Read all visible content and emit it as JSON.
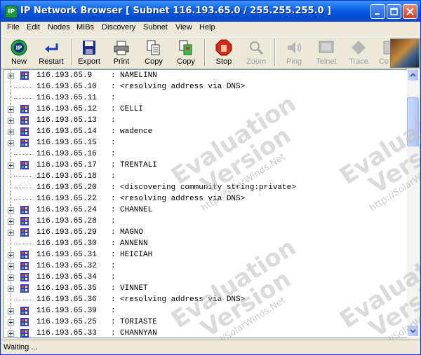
{
  "window": {
    "title": "IP Network Browser [ Subnet 116.193.65.0 / 255.255.255.0 ]",
    "app_icon_text": "IP"
  },
  "menu": [
    "File",
    "Edit",
    "Nodes",
    "MIBs",
    "Discovery",
    "Subnet",
    "View",
    "Help"
  ],
  "toolbar": {
    "new": "New",
    "restart": "Restart",
    "export": "Export",
    "print": "Print",
    "copy1": "Copy",
    "copy2": "Copy",
    "stop": "Stop",
    "zoom": "Zoom",
    "ping": "Ping",
    "telnet": "Telnet",
    "trace": "Trace",
    "co": "Co"
  },
  "rows": [
    {
      "ip": "116.193.65.9",
      "name": "NAMELINN",
      "expand": true
    },
    {
      "ip": "116.193.65.10",
      "name": "<resolving address via DNS>",
      "expand": false
    },
    {
      "ip": "116.193.65.11",
      "name": "",
      "expand": false
    },
    {
      "ip": "116.193.65.12",
      "name": "CELLI",
      "expand": true
    },
    {
      "ip": "116.193.65.13",
      "name": "",
      "expand": true
    },
    {
      "ip": "116.193.65.14",
      "name": "wadence",
      "expand": true
    },
    {
      "ip": "116.193.65.15",
      "name": "",
      "expand": true
    },
    {
      "ip": "116.193.65.16",
      "name": "",
      "expand": false
    },
    {
      "ip": "116.193.65.17",
      "name": "TRENTALI",
      "expand": true
    },
    {
      "ip": "116.193.65.18",
      "name": "",
      "expand": false
    },
    {
      "ip": "116.193.65.20",
      "name": "<discovering community string:private>",
      "expand": false
    },
    {
      "ip": "116.193.65.22",
      "name": "<resolving address via DNS>",
      "expand": false
    },
    {
      "ip": "116.193.65.24",
      "name": "CHANNEL",
      "expand": true
    },
    {
      "ip": "116.193.65.28",
      "name": "",
      "expand": true
    },
    {
      "ip": "116.193.65.29",
      "name": "MAGNO",
      "expand": true
    },
    {
      "ip": "116.193.65.30",
      "name": "ANNENN",
      "expand": false
    },
    {
      "ip": "116.193.65.31",
      "name": "HEICIAH",
      "expand": true
    },
    {
      "ip": "116.193.65.32",
      "name": "",
      "expand": true
    },
    {
      "ip": "116.193.65.34",
      "name": "",
      "expand": true
    },
    {
      "ip": "116.193.65.35",
      "name": "VINNET",
      "expand": true
    },
    {
      "ip": "116.193.65.36",
      "name": "<resolving address via DNS>",
      "expand": false
    },
    {
      "ip": "116.193.65.39",
      "name": "",
      "expand": true
    },
    {
      "ip": "116.193.65.25",
      "name": "TORIASTE",
      "expand": true
    },
    {
      "ip": "116.193.65.33",
      "name": "CHANNYAN",
      "expand": true
    }
  ],
  "watermark": {
    "line1": "Evaluation",
    "line2": "Version",
    "url": "http://SolarWinds.Net"
  },
  "status": "Waiting ...",
  "colors": {
    "title_blue": "#0a5fe6",
    "stop_red": "#d9261c",
    "node_icon": "#3a3acb"
  }
}
